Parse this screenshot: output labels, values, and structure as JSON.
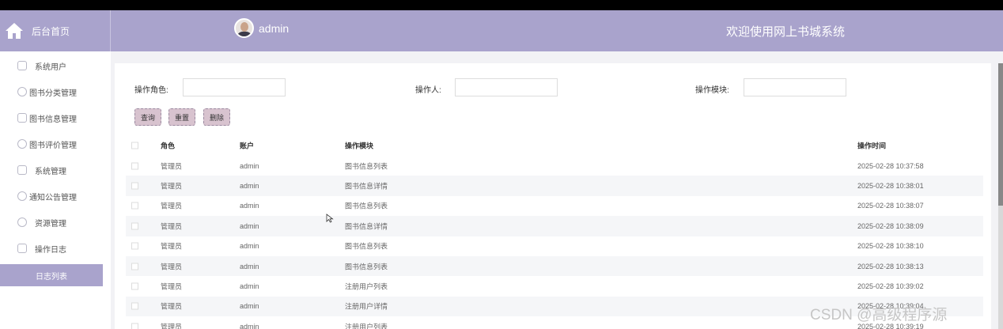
{
  "header": {
    "home_label": "后台首页",
    "username": "admin",
    "welcome": "欢迎使用网上书城系统",
    "bg_color": "#a9a3cc"
  },
  "sidebar": {
    "items": [
      {
        "label": "系统用户",
        "icon": "user-icon"
      },
      {
        "label": "图书分类管理",
        "icon": "category-icon"
      },
      {
        "label": "图书信息管理",
        "icon": "book-icon"
      },
      {
        "label": "图书评价管理",
        "icon": "comment-icon"
      },
      {
        "label": "系统管理",
        "icon": "settings-icon"
      },
      {
        "label": "通知公告管理",
        "icon": "notice-icon"
      },
      {
        "label": "资源管理",
        "icon": "resource-icon"
      },
      {
        "label": "操作日志",
        "icon": "log-icon"
      }
    ],
    "active_sub": "日志列表"
  },
  "filters": {
    "role_label": "操作角色:",
    "operator_label": "操作人:",
    "module_label": "操作模块:"
  },
  "buttons": {
    "query": "查询",
    "reset": "重置",
    "delete": "删除"
  },
  "table": {
    "headers": [
      "角色",
      "账户",
      "操作模块",
      "操作时间"
    ],
    "rows": [
      [
        "管理员",
        "admin",
        "图书信息列表",
        "2025-02-28 10:37:58"
      ],
      [
        "管理员",
        "admin",
        "图书信息详情",
        "2025-02-28 10:38:01"
      ],
      [
        "管理员",
        "admin",
        "图书信息列表",
        "2025-02-28 10:38:07"
      ],
      [
        "管理员",
        "admin",
        "图书信息详情",
        "2025-02-28 10:38:09"
      ],
      [
        "管理员",
        "admin",
        "图书信息列表",
        "2025-02-28 10:38:10"
      ],
      [
        "管理员",
        "admin",
        "图书信息列表",
        "2025-02-28 10:38:13"
      ],
      [
        "管理员",
        "admin",
        "注册用户列表",
        "2025-02-28 10:39:02"
      ],
      [
        "管理员",
        "admin",
        "注册用户详情",
        "2025-02-28 10:39:04"
      ],
      [
        "管理员",
        "admin",
        "注册用户列表",
        "2025-02-28 10:39:19"
      ]
    ]
  },
  "watermark": "CSDN @高级程序源"
}
